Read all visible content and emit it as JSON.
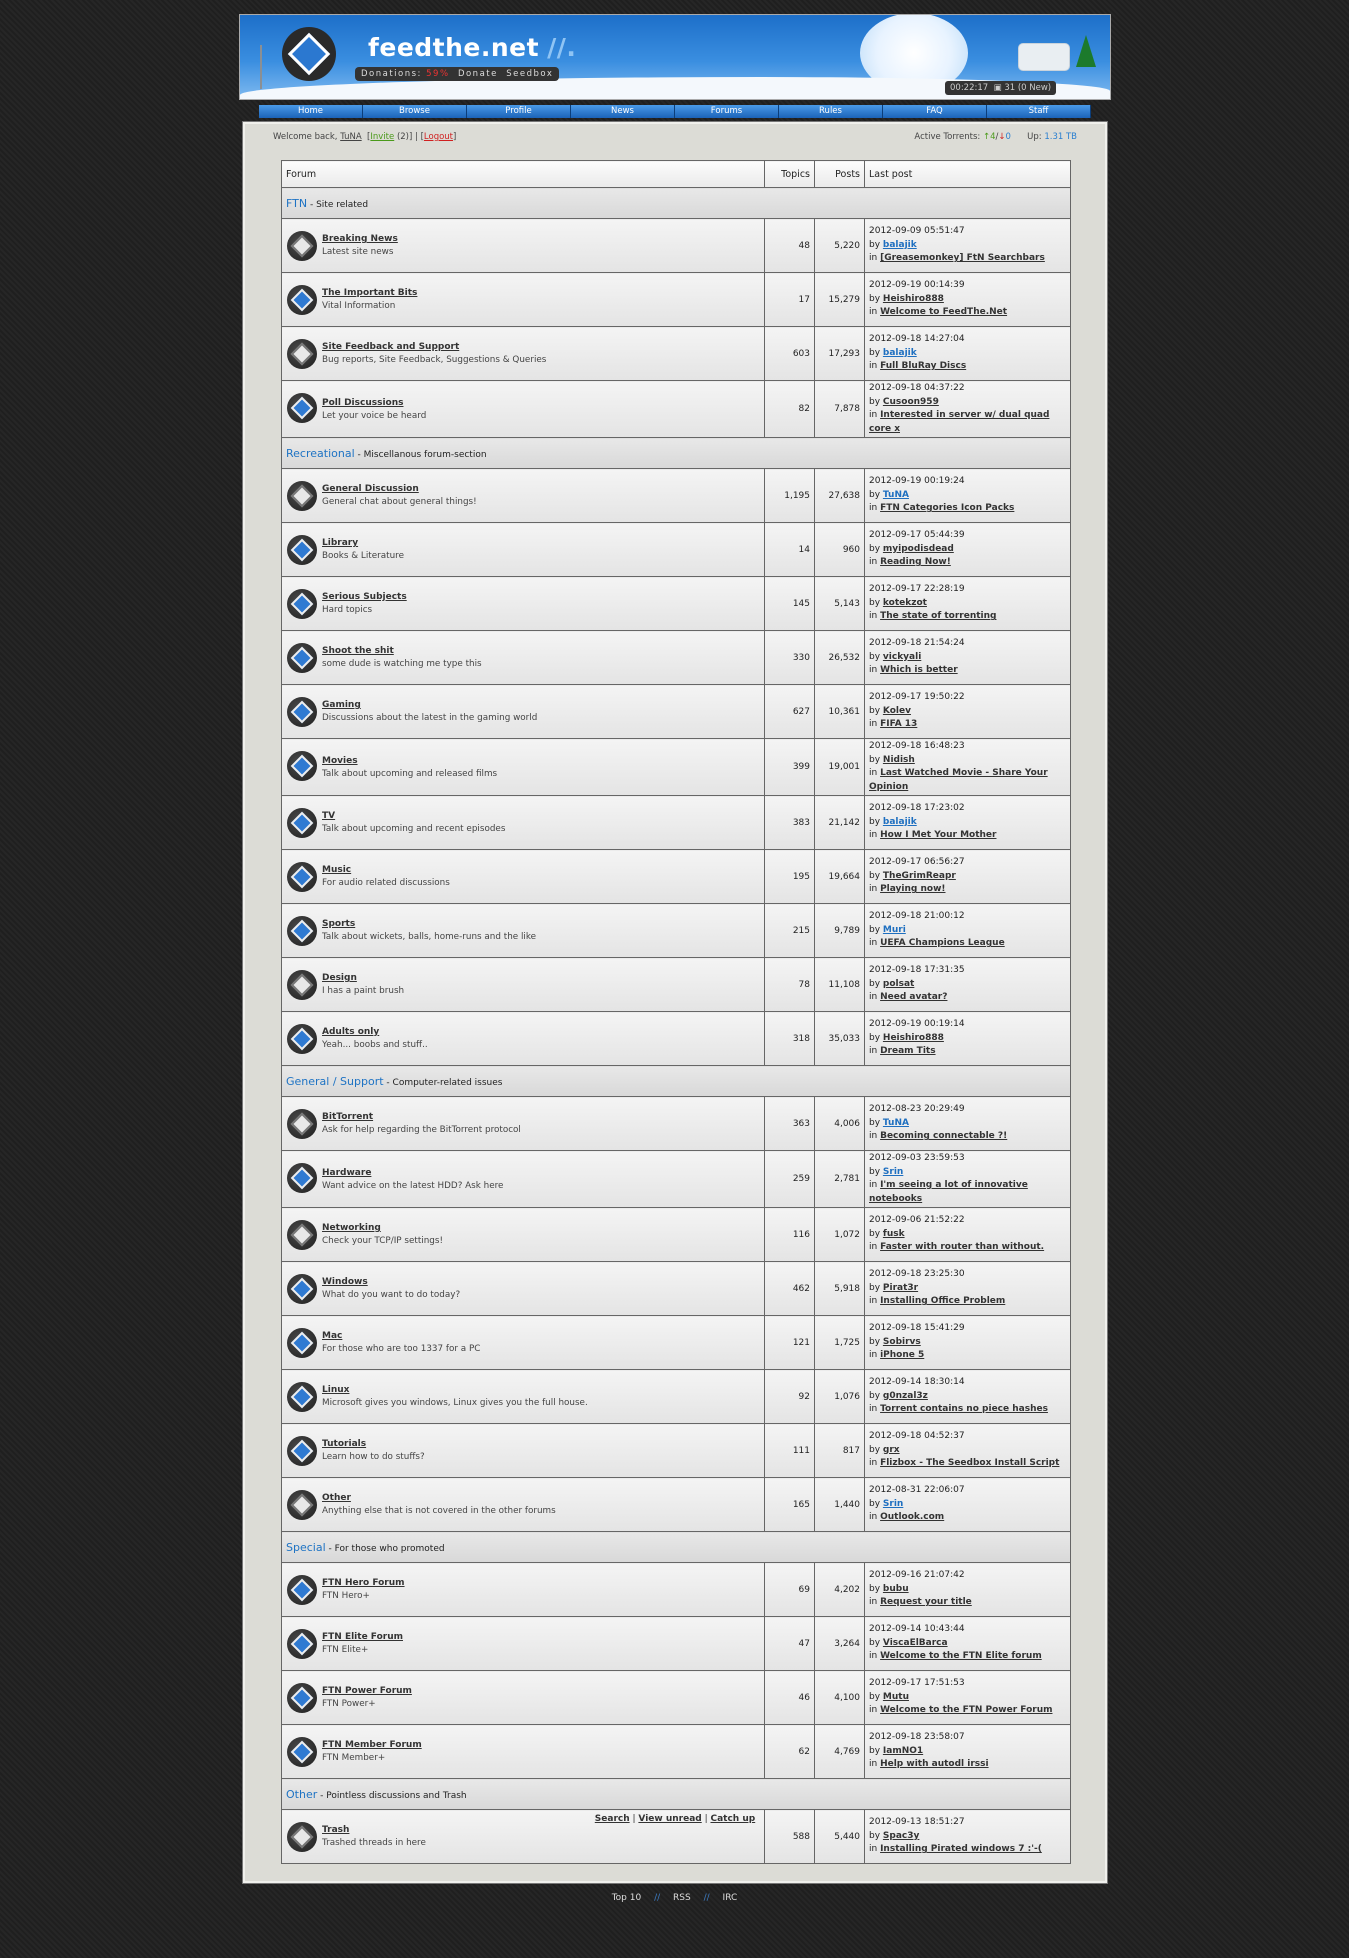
{
  "header": {
    "site_name": "feedthe.net",
    "site_slashes": "//.",
    "donations_label": "Donations:",
    "donations_pct": "59%",
    "donate_link": "Donate",
    "seedbox_link": "Seedbox",
    "clock_text": "00:22:17",
    "messages_text": "31 (0 New)"
  },
  "nav": [
    "Home",
    "Browse",
    "Profile",
    "News",
    "Forums",
    "Rules",
    "FAQ",
    "Staff"
  ],
  "topbar": {
    "welcome_prefix": "Welcome back, ",
    "username": "TuNA",
    "invite_label": "Invite",
    "invite_count": "(2)",
    "logout_label": "Logout",
    "active_label": "Active Torrents:",
    "active_up": "4",
    "active_down": "0",
    "up_label": "Up:",
    "up_value": "1.31 TB"
  },
  "table_headers": {
    "forum": "Forum",
    "topics": "Topics",
    "posts": "Posts",
    "last_post": "Last post"
  },
  "categories": [
    {
      "name": "FTN",
      "desc": "Site related",
      "forums": [
        {
          "name": "Breaking News",
          "desc": "Latest site news",
          "topics": "48",
          "posts": "5,220",
          "date": "2012-09-09 05:51:47",
          "user": "balajik",
          "user_color": "blue",
          "topic": "[Greasemonkey] FtN Searchbars",
          "unread": false
        },
        {
          "name": "The Important Bits",
          "desc": "Vital Information",
          "topics": "17",
          "posts": "15,279",
          "date": "2012-09-19 00:14:39",
          "user": "Heishiro888",
          "user_color": "dark",
          "topic": "Welcome to FeedThe.Net",
          "unread": true
        },
        {
          "name": "Site Feedback and Support",
          "desc": "Bug reports, Site Feedback, Suggestions & Queries",
          "topics": "603",
          "posts": "17,293",
          "date": "2012-09-18 14:27:04",
          "user": "balajik",
          "user_color": "blue",
          "topic": "Full BluRay Discs",
          "unread": false
        },
        {
          "name": "Poll Discussions",
          "desc": "Let your voice be heard",
          "topics": "82",
          "posts": "7,878",
          "date": "2012-09-18 04:37:22",
          "user": "Cusoon959",
          "user_color": "dark",
          "topic": "Interested in server w/ dual quad core x",
          "unread": true
        }
      ]
    },
    {
      "name": "Recreational",
      "desc": "Miscellanous forum-section",
      "forums": [
        {
          "name": "General Discussion",
          "desc": "General chat about general things!",
          "topics": "1,195",
          "posts": "27,638",
          "date": "2012-09-19 00:19:24",
          "user": "TuNA",
          "user_color": "blue",
          "topic": "FTN Categories Icon Packs",
          "unread": false
        },
        {
          "name": "Library",
          "desc": "Books & Literature",
          "topics": "14",
          "posts": "960",
          "date": "2012-09-17 05:44:39",
          "user": "myipodisdead",
          "user_color": "dark",
          "topic": "Reading Now!",
          "unread": true
        },
        {
          "name": "Serious Subjects",
          "desc": "Hard topics",
          "topics": "145",
          "posts": "5,143",
          "date": "2012-09-17 22:28:19",
          "user": "kotekzot",
          "user_color": "dark",
          "topic": "The state of torrenting",
          "unread": true
        },
        {
          "name": "Shoot the shit",
          "desc": "some dude is watching me type this",
          "topics": "330",
          "posts": "26,532",
          "date": "2012-09-18 21:54:24",
          "user": "vickyali",
          "user_color": "dark",
          "topic": "Which is better",
          "unread": true
        },
        {
          "name": "Gaming",
          "desc": "Discussions about the latest in the gaming world",
          "topics": "627",
          "posts": "10,361",
          "date": "2012-09-17 19:50:22",
          "user": "Kolev",
          "user_color": "dark",
          "topic": "FIFA 13",
          "unread": true
        },
        {
          "name": "Movies",
          "desc": "Talk about upcoming and released films",
          "topics": "399",
          "posts": "19,001",
          "date": "2012-09-18 16:48:23",
          "user": "Nidish",
          "user_color": "dark",
          "topic": "Last Watched Movie - Share Your Opinion",
          "unread": true
        },
        {
          "name": "TV",
          "desc": "Talk about upcoming and recent episodes",
          "topics": "383",
          "posts": "21,142",
          "date": "2012-09-18 17:23:02",
          "user": "balajik",
          "user_color": "blue",
          "topic": "How I Met Your Mother",
          "unread": true
        },
        {
          "name": "Music",
          "desc": "For audio related discussions",
          "topics": "195",
          "posts": "19,664",
          "date": "2012-09-17 06:56:27",
          "user": "TheGrimReapr",
          "user_color": "dark",
          "topic": "Playing now!",
          "unread": true
        },
        {
          "name": "Sports",
          "desc": "Talk about wickets, balls, home-runs and the like",
          "topics": "215",
          "posts": "9,789",
          "date": "2012-09-18 21:00:12",
          "user": "Muri",
          "user_color": "blue",
          "topic": "UEFA Champions League",
          "unread": true
        },
        {
          "name": "Design",
          "desc": "I has a paint brush",
          "topics": "78",
          "posts": "11,108",
          "date": "2012-09-18 17:31:35",
          "user": "polsat",
          "user_color": "dark",
          "topic": "Need avatar?",
          "unread": false
        },
        {
          "name": "Adults only",
          "desc": "Yeah... boobs and stuff..",
          "topics": "318",
          "posts": "35,033",
          "date": "2012-09-19 00:19:14",
          "user": "Heishiro888",
          "user_color": "dark",
          "topic": "Dream Tits",
          "unread": true
        }
      ]
    },
    {
      "name": "General / Support",
      "desc": "Computer-related issues",
      "forums": [
        {
          "name": "BitTorrent",
          "desc": "Ask for help regarding the BitTorrent protocol",
          "topics": "363",
          "posts": "4,006",
          "date": "2012-08-23 20:29:49",
          "user": "TuNA",
          "user_color": "blue",
          "topic": "Becoming connectable ?!",
          "unread": false
        },
        {
          "name": "Hardware",
          "desc": "Want advice on the latest HDD? Ask here",
          "topics": "259",
          "posts": "2,781",
          "date": "2012-09-03 23:59:53",
          "user": "Srin",
          "user_color": "blue",
          "topic": "I'm seeing a lot of innovative notebooks",
          "unread": true
        },
        {
          "name": "Networking",
          "desc": "Check your TCP/IP settings!",
          "topics": "116",
          "posts": "1,072",
          "date": "2012-09-06 21:52:22",
          "user": "fusk",
          "user_color": "dark",
          "topic": "Faster with router than without.",
          "unread": false
        },
        {
          "name": "Windows",
          "desc": "What do you want to do today?",
          "topics": "462",
          "posts": "5,918",
          "date": "2012-09-18 23:25:30",
          "user": "Pirat3r",
          "user_color": "dark",
          "topic": "Installing Office Problem",
          "unread": true
        },
        {
          "name": "Mac",
          "desc": "For those who are too 1337 for a PC",
          "topics": "121",
          "posts": "1,725",
          "date": "2012-09-18 15:41:29",
          "user": "Sobirvs",
          "user_color": "dark",
          "topic": "iPhone 5",
          "unread": true
        },
        {
          "name": "Linux",
          "desc": "Microsoft gives you windows, Linux gives you the full house.",
          "topics": "92",
          "posts": "1,076",
          "date": "2012-09-14 18:30:14",
          "user": "g0nzal3z",
          "user_color": "dark",
          "topic": "Torrent contains no piece hashes",
          "unread": true
        },
        {
          "name": "Tutorials",
          "desc": "Learn how to do stuffs?",
          "topics": "111",
          "posts": "817",
          "date": "2012-09-18 04:52:37",
          "user": "grx",
          "user_color": "dark",
          "topic": "Flizbox - The Seedbox Install Script",
          "unread": true
        },
        {
          "name": "Other",
          "desc": "Anything else that is not covered in the other forums",
          "topics": "165",
          "posts": "1,440",
          "date": "2012-08-31 22:06:07",
          "user": "Srin",
          "user_color": "blue",
          "topic": "Outlook.com",
          "unread": false
        }
      ]
    },
    {
      "name": "Special",
      "desc": "For those who promoted",
      "forums": [
        {
          "name": "FTN Hero Forum",
          "desc": "FTN Hero+",
          "topics": "69",
          "posts": "4,202",
          "date": "2012-09-16 21:07:42",
          "user": "bubu",
          "user_color": "dark",
          "topic": "Request your title",
          "unread": true
        },
        {
          "name": "FTN Elite Forum",
          "desc": "FTN Elite+",
          "topics": "47",
          "posts": "3,264",
          "date": "2012-09-14 10:43:44",
          "user": "ViscaElBarca",
          "user_color": "dark",
          "topic": "Welcome to the FTN Elite forum",
          "unread": true
        },
        {
          "name": "FTN Power Forum",
          "desc": "FTN Power+",
          "topics": "46",
          "posts": "4,100",
          "date": "2012-09-17 17:51:53",
          "user": "Mutu",
          "user_color": "dark",
          "topic": "Welcome to the FTN Power Forum",
          "unread": true
        },
        {
          "name": "FTN Member Forum",
          "desc": "FTN Member+",
          "topics": "62",
          "posts": "4,769",
          "date": "2012-09-18 23:58:07",
          "user": "IamNO1",
          "user_color": "dark",
          "topic": "Help with autodl irssi",
          "unread": true
        }
      ]
    },
    {
      "name": "Other",
      "desc": "Pointless discussions and Trash",
      "forums": [
        {
          "name": "Trash",
          "desc": "Trashed threads in here",
          "topics": "588",
          "posts": "5,440",
          "date": "2012-09-13 18:51:27",
          "user": "Spac3y",
          "user_color": "dark",
          "topic": "Installing Pirated windows 7 :'-(",
          "unread": false
        }
      ]
    }
  ],
  "bottom_links": [
    "Search",
    "View unread",
    "Catch up"
  ],
  "footer_links": [
    "Top 10",
    "RSS",
    "IRC"
  ],
  "footer_sep": "//"
}
